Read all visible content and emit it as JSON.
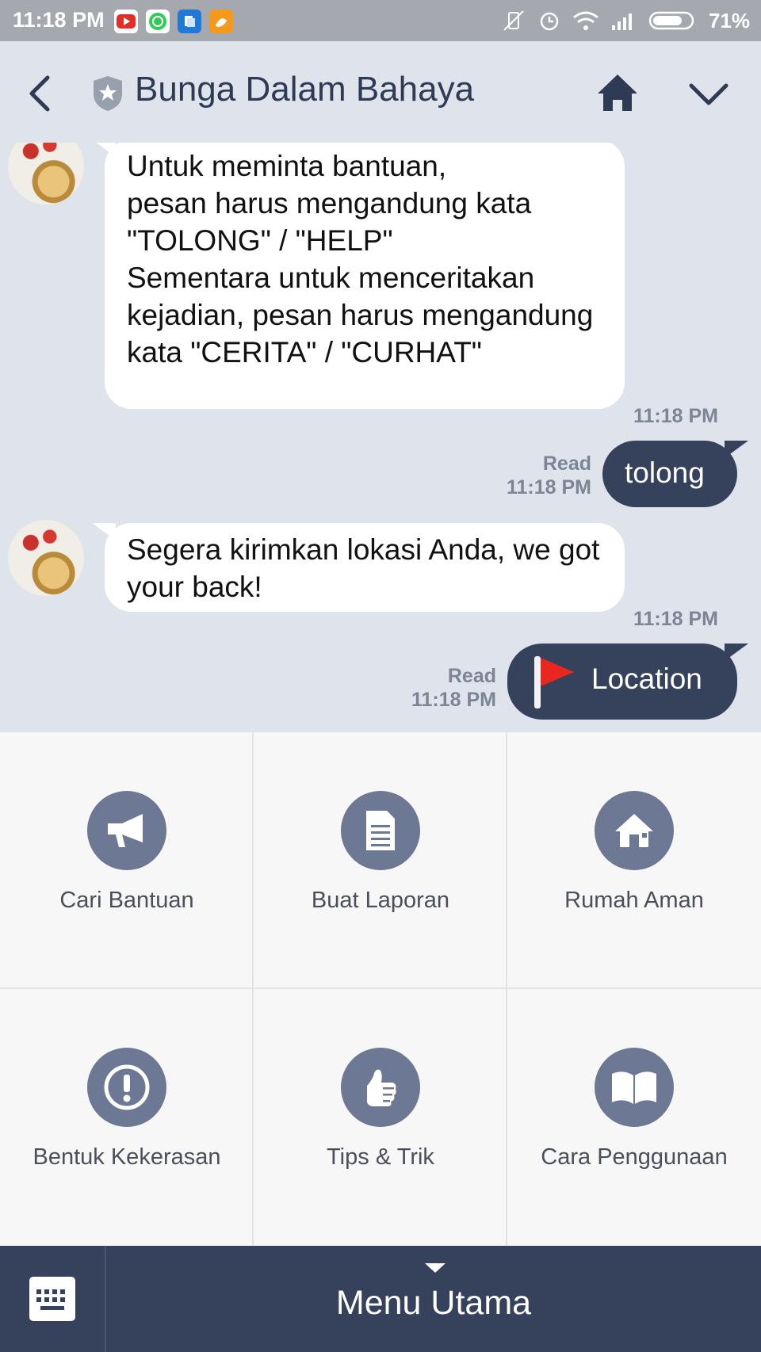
{
  "status_bar": {
    "time": "11:18 PM",
    "battery": "71%"
  },
  "header": {
    "title": "Bunga Dalam Bahaya"
  },
  "messages": [
    {
      "direction": "in",
      "text": "Untuk meminta bantuan,\npesan harus mengandung kata \"TOLONG\" / \"HELP\"\nSementara untuk menceritakan kejadian, pesan harus mengandung kata  \"CERITA\" / \"CURHAT\"",
      "time": "11:18 PM"
    },
    {
      "direction": "out",
      "text": "tolong",
      "read": "Read",
      "time": "11:18 PM"
    },
    {
      "direction": "in",
      "text": "Segera kirimkan lokasi Anda, we got your back!",
      "time": "11:18 PM"
    },
    {
      "direction": "out",
      "text": "Location",
      "read": "Read",
      "time": "11:18 PM"
    }
  ],
  "menu": {
    "items": [
      {
        "label": "Cari Bantuan",
        "icon": "megaphone-icon"
      },
      {
        "label": "Buat Laporan",
        "icon": "document-icon"
      },
      {
        "label": "Rumah Aman",
        "icon": "house-icon"
      },
      {
        "label": "Bentuk Kekerasan",
        "icon": "exclamation-icon"
      },
      {
        "label": "Tips & Trik",
        "icon": "thumbs-up-icon"
      },
      {
        "label": "Cara Penggunaan",
        "icon": "book-icon"
      }
    ],
    "bottom_label": "Menu Utama"
  },
  "colors": {
    "chat_background": "#dfe3ec",
    "outgoing_bubble": "#36415b",
    "menu_icon_circle": "#6c7894"
  }
}
